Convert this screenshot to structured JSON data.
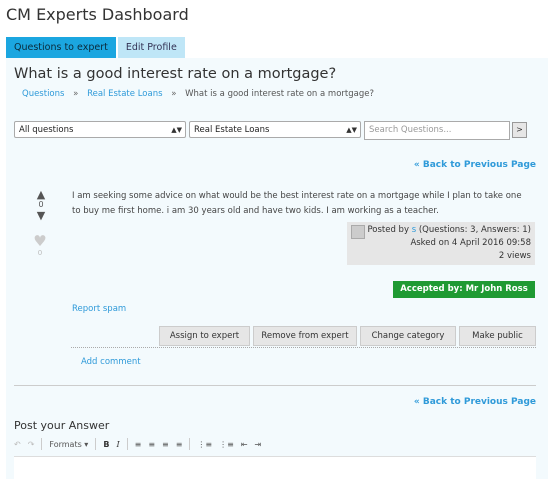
{
  "app_title": "CM Experts Dashboard",
  "tabs": [
    {
      "label": "Questions to expert",
      "active": true
    },
    {
      "label": "Edit Profile",
      "active": false
    }
  ],
  "question": {
    "title": "What is a good interest rate on a mortgage?",
    "breadcrumb": [
      "Questions",
      "Real Estate Loans",
      "What is a good interest rate on a mortgage?"
    ],
    "breadcrumb_sep": "»",
    "body": "I am seeking some advice on what would be the best interest rate on a mortgage while I plan to take one to buy me first home. i am 30 years old and have two kids. I am working as a teacher.",
    "vote_count": "0",
    "favorite_count": "0",
    "author_prefix": "Posted by",
    "author_name": "s",
    "author_stats": "(Questions: 3, Answers: 1)",
    "asked_on": "Asked on 4 April 2016 09:58",
    "views": "2 views",
    "accepted_by": "Accepted by: Mr John Ross",
    "report_spam": "Report spam",
    "add_comment": "Add comment"
  },
  "filters": {
    "category_select": "All questions",
    "subcategory_select": "Real Estate Loans",
    "search_placeholder": "Search Questions...",
    "search_button": ">"
  },
  "back_link": "« Back to Previous Page",
  "actions": [
    "Assign to expert",
    "Remove from expert",
    "Change category",
    "Make public"
  ],
  "answer": {
    "title": "Post your Answer",
    "formats_label": "Formats"
  },
  "icons": {
    "vote_up": "triangle-up-icon",
    "vote_down": "triangle-down-icon",
    "favorite": "heart-icon",
    "undo": "undo-icon",
    "redo": "redo-icon"
  },
  "colors": {
    "tab_active": "#1ba6e0",
    "tab_inactive": "#bfe6f7",
    "panel": "#f3fafd",
    "link": "#2f9ad9",
    "accepted": "#1f9a33"
  }
}
